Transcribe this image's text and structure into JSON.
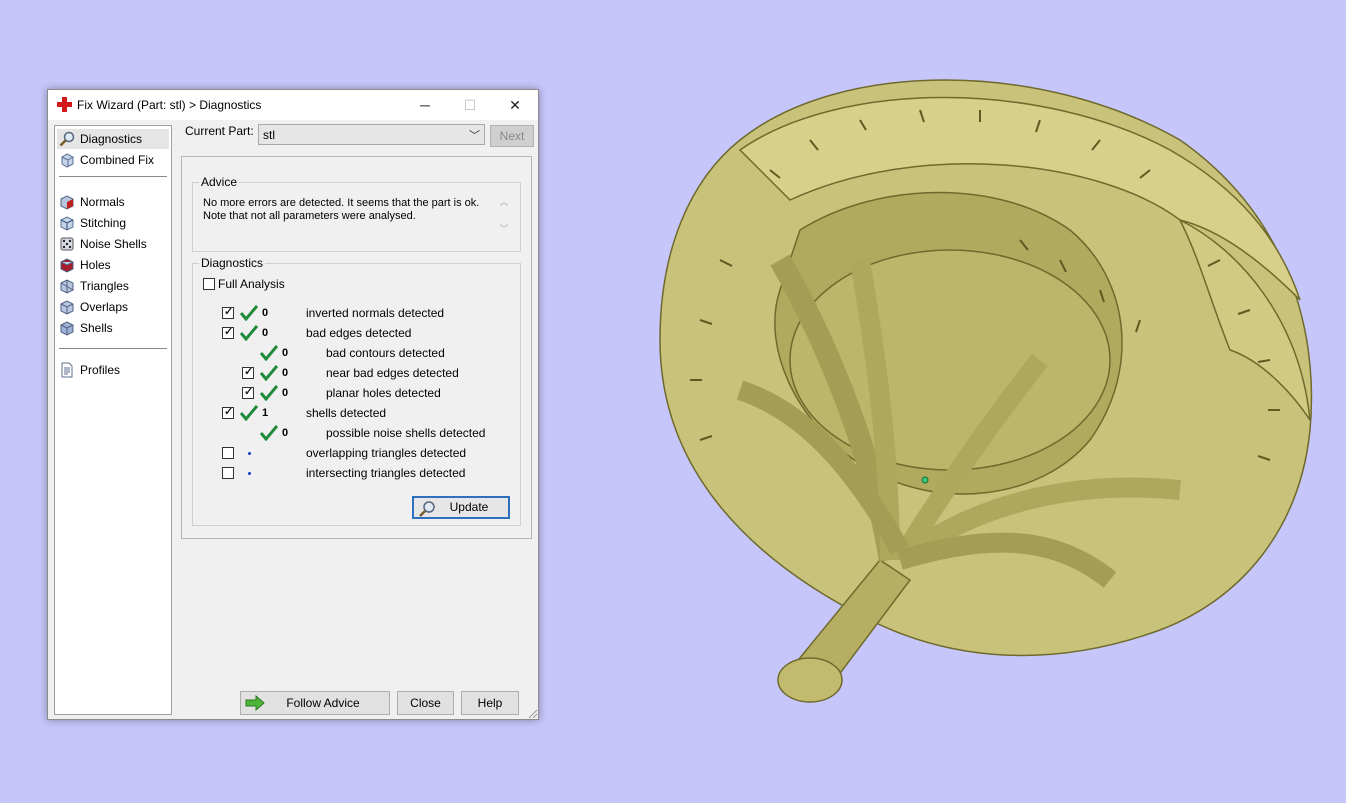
{
  "window": {
    "title": "Fix Wizard (Part: stl) > Diagnostics",
    "controls": {
      "minimize": "─",
      "maximize": "☐",
      "close": "✕"
    }
  },
  "nav": {
    "items": [
      {
        "label": "Diagnostics",
        "icon": "magnifier-icon",
        "selected": true
      },
      {
        "label": "Combined Fix",
        "icon": "cube-icon"
      },
      {
        "label": "Normals",
        "icon": "normals-cube-icon"
      },
      {
        "label": "Stitching",
        "icon": "stitching-cube-icon"
      },
      {
        "label": "Noise Shells",
        "icon": "dice-icon"
      },
      {
        "label": "Holes",
        "icon": "holes-cube-icon"
      },
      {
        "label": "Triangles",
        "icon": "triangles-cube-icon"
      },
      {
        "label": "Overlaps",
        "icon": "overlaps-cube-icon"
      },
      {
        "label": "Shells",
        "icon": "shells-cube-icon"
      },
      {
        "label": "Profiles",
        "icon": "document-icon"
      }
    ]
  },
  "current_part": {
    "label": "Current Part:",
    "value": "stl",
    "next_label": "Next"
  },
  "advice": {
    "title": "Advice",
    "line1": "No more errors are detected. It seems that the part is ok.",
    "line2": "Note that not all parameters were analysed."
  },
  "diagnostics": {
    "title": "Diagnostics",
    "full_analysis_label": "Full Analysis",
    "rows": [
      {
        "checkbox": true,
        "checked": true,
        "status": "ok",
        "count": "0",
        "label": "inverted normals detected",
        "indent": 0
      },
      {
        "checkbox": true,
        "checked": true,
        "status": "ok",
        "count": "0",
        "label": "bad edges detected",
        "indent": 0
      },
      {
        "checkbox": false,
        "checked": false,
        "status": "ok",
        "count": "0",
        "label": "bad contours detected",
        "indent": 1
      },
      {
        "checkbox": true,
        "checked": true,
        "status": "ok",
        "count": "0",
        "label": "near bad edges detected",
        "indent": 1
      },
      {
        "checkbox": true,
        "checked": true,
        "status": "ok",
        "count": "0",
        "label": "planar holes detected",
        "indent": 1
      },
      {
        "checkbox": true,
        "checked": true,
        "status": "ok",
        "count": "1",
        "label": "shells detected",
        "indent": 0
      },
      {
        "checkbox": false,
        "checked": false,
        "status": "ok",
        "count": "0",
        "label": "possible noise shells detected",
        "indent": 1
      },
      {
        "checkbox": true,
        "checked": false,
        "status": "none",
        "count": "",
        "label": "overlapping triangles detected",
        "indent": 0
      },
      {
        "checkbox": true,
        "checked": false,
        "status": "none",
        "count": "",
        "label": "intersecting triangles detected",
        "indent": 0
      }
    ],
    "update_label": "Update"
  },
  "buttons": {
    "follow_advice": "Follow Advice",
    "close": "Close",
    "help": "Help"
  },
  "colors": {
    "background": "#c7c6fb",
    "model": "#c9c27a",
    "check": "#1f8a3a",
    "dot": "#1a3cc9"
  }
}
